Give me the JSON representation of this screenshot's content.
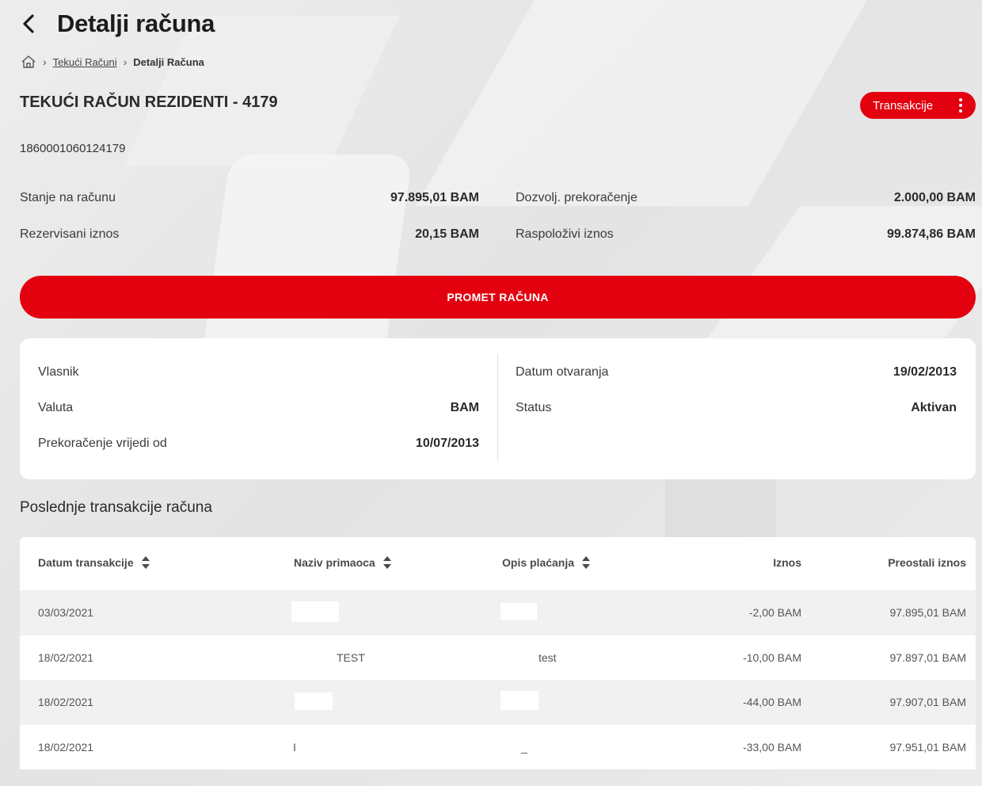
{
  "header": {
    "title": "Detalji računa"
  },
  "breadcrumb": {
    "link": "Tekući Računi",
    "current": "Detalji Računa"
  },
  "account": {
    "name": "TEKUĆI RAČUN REZIDENTI - 4179",
    "number": "1860001060124179",
    "actions_label": "Transakcije"
  },
  "balances": {
    "stanje_label": "Stanje na računu",
    "stanje_value": "97.895,01 BAM",
    "rezervisani_label": "Rezervisani iznos",
    "rezervisani_value": "20,15 BAM",
    "dozvolj_label": "Dozvolj. prekoračenje",
    "dozvolj_value": "2.000,00 BAM",
    "raspolozivi_label": "Raspoloživi iznos",
    "raspolozivi_value": "99.874,86 BAM"
  },
  "promet_button": "PROMET RAČUNA",
  "details": {
    "vlasnik_label": "Vlasnik",
    "vlasnik_value": "",
    "valuta_label": "Valuta",
    "valuta_value": "BAM",
    "prekoracenje_label": "Prekoračenje vrijedi od",
    "prekoracenje_value": "10/07/2013",
    "datum_label": "Datum otvaranja",
    "datum_value": "19/02/2013",
    "status_label": "Status",
    "status_value": "Aktivan"
  },
  "transactions": {
    "title": "Poslednje transakcije računa",
    "columns": [
      "Datum transakcije",
      "Naziv primaoca",
      "Opis plaćanja",
      "Iznos",
      "Preostali iznos"
    ],
    "rows": [
      {
        "date": "03/03/2021",
        "recipient": "",
        "description": "",
        "amount": "-2,00 BAM",
        "balance": "97.895,01 BAM"
      },
      {
        "date": "18/02/2021",
        "recipient": "TEST",
        "description": "test",
        "amount": "-10,00 BAM",
        "balance": "97.897,01 BAM"
      },
      {
        "date": "18/02/2021",
        "recipient": "",
        "description": "",
        "amount": "-44,00 BAM",
        "balance": "97.907,01 BAM"
      },
      {
        "date": "18/02/2021",
        "recipient": "I",
        "description": "_",
        "amount": "-33,00 BAM",
        "balance": "97.951,01 BAM"
      }
    ]
  },
  "colors": {
    "accent": "#e3000f",
    "card": "#ffffff",
    "row_alt": "#f1f1f1"
  },
  "icons": {
    "back": "chevron-left-icon",
    "home": "home-icon",
    "more": "kebab-icon",
    "sort": "sort-icon"
  }
}
